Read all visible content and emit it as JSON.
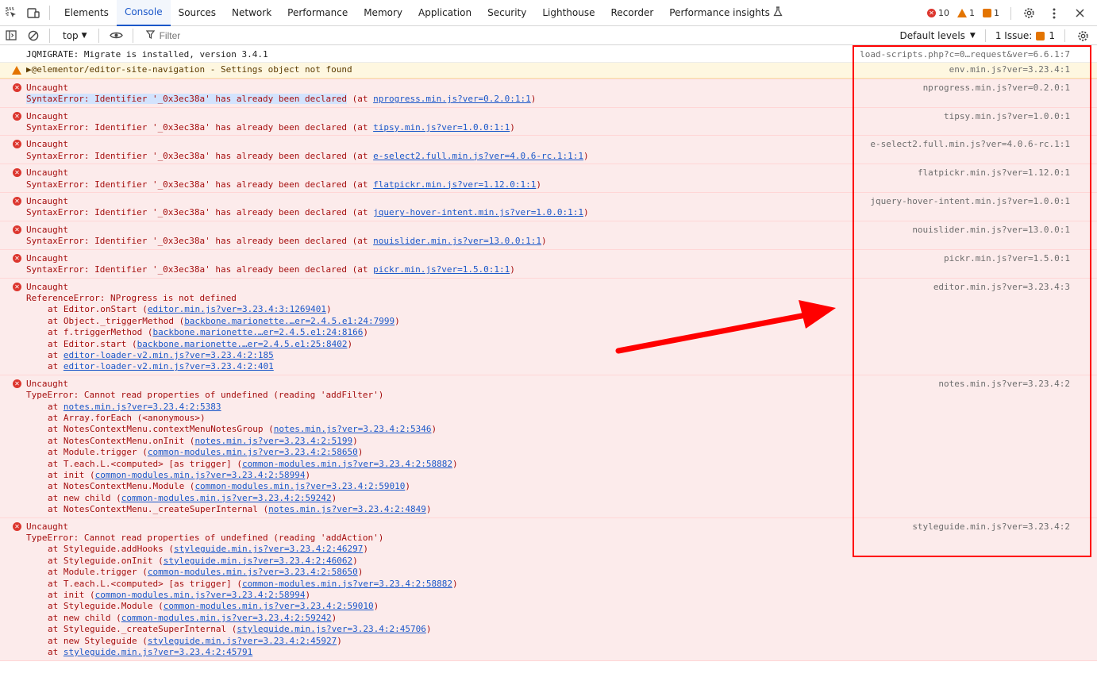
{
  "tabs": [
    {
      "label": "Elements",
      "active": false
    },
    {
      "label": "Console",
      "active": true
    },
    {
      "label": "Sources",
      "active": false
    },
    {
      "label": "Network",
      "active": false
    },
    {
      "label": "Performance",
      "active": false
    },
    {
      "label": "Memory",
      "active": false
    },
    {
      "label": "Application",
      "active": false
    },
    {
      "label": "Security",
      "active": false
    },
    {
      "label": "Lighthouse",
      "active": false
    },
    {
      "label": "Recorder",
      "active": false
    },
    {
      "label": "Performance insights",
      "active": false
    }
  ],
  "counts": {
    "errors": "10",
    "warnings": "1",
    "issues": "1"
  },
  "toolbar": {
    "context": "top",
    "filter_placeholder": "Filter",
    "levels": "Default levels",
    "issues": "1 Issue:",
    "issues_count": "1"
  },
  "messages": [
    {
      "level": "info",
      "lines": [
        [
          "JQMIGRATE: Migrate is installed, version 3.4.1"
        ]
      ],
      "source": "load-scripts.php?c=0…request&ver=6.6.1:7"
    },
    {
      "level": "warn",
      "lines": [
        [
          "▶@elementor/editor-site-navigation - Settings object not found"
        ]
      ],
      "source": "env.min.js?ver=3.23.4:1"
    },
    {
      "level": "error",
      "lines": [
        [
          "Uncaught"
        ],
        [
          "SyntaxError: Identifier '_0x3ec38a' has already been declared",
          " (at ",
          "nprogress.min.js?ver=0.2.0:1:1",
          ")"
        ]
      ],
      "source": "nprogress.min.js?ver=0.2.0:1",
      "highlight": true
    },
    {
      "level": "error",
      "lines": [
        [
          "Uncaught"
        ],
        [
          "SyntaxError: Identifier '_0x3ec38a' has already been declared",
          " (at ",
          "tipsy.min.js?ver=1.0.0:1:1",
          ")"
        ]
      ],
      "source": "tipsy.min.js?ver=1.0.0:1"
    },
    {
      "level": "error",
      "lines": [
        [
          "Uncaught"
        ],
        [
          "SyntaxError: Identifier '_0x3ec38a' has already been declared",
          " (at ",
          "e-select2.full.min.js?ver=4.0.6-rc.1:1:1",
          ")"
        ]
      ],
      "source": "e-select2.full.min.js?ver=4.0.6-rc.1:1"
    },
    {
      "level": "error",
      "lines": [
        [
          "Uncaught"
        ],
        [
          "SyntaxError: Identifier '_0x3ec38a' has already been declared",
          " (at ",
          "flatpickr.min.js?ver=1.12.0:1:1",
          ")"
        ]
      ],
      "source": "flatpickr.min.js?ver=1.12.0:1"
    },
    {
      "level": "error",
      "lines": [
        [
          "Uncaught"
        ],
        [
          "SyntaxError: Identifier '_0x3ec38a' has already been declared",
          " (at ",
          "jquery-hover-intent.min.js?ver=1.0.0:1:1",
          ")"
        ]
      ],
      "source": "jquery-hover-intent.min.js?ver=1.0.0:1"
    },
    {
      "level": "error",
      "lines": [
        [
          "Uncaught"
        ],
        [
          "SyntaxError: Identifier '_0x3ec38a' has already been declared",
          " (at ",
          "nouislider.min.js?ver=13.0.0:1:1",
          ")"
        ]
      ],
      "source": "nouislider.min.js?ver=13.0.0:1"
    },
    {
      "level": "error",
      "lines": [
        [
          "Uncaught"
        ],
        [
          "SyntaxError: Identifier '_0x3ec38a' has already been declared",
          " (at ",
          "pickr.min.js?ver=1.5.0:1:1",
          ")"
        ]
      ],
      "source": "pickr.min.js?ver=1.5.0:1"
    },
    {
      "level": "error",
      "lines": [
        [
          "Uncaught"
        ],
        [
          "ReferenceError: NProgress is not defined"
        ]
      ],
      "source": "editor.min.js?ver=3.23.4:3",
      "stack": [
        [
          "at Editor.onStart (",
          "editor.min.js?ver=3.23.4:3:1269401",
          ")"
        ],
        [
          "at Object._triggerMethod (",
          "backbone.marionette.…er=2.4.5.e1:24:7999",
          ")"
        ],
        [
          "at f.triggerMethod (",
          "backbone.marionette.…er=2.4.5.e1:24:8166",
          ")"
        ],
        [
          "at Editor.start (",
          "backbone.marionette.…er=2.4.5.e1:25:8402",
          ")"
        ],
        [
          "at ",
          "editor-loader-v2.min.js?ver=3.23.4:2:185",
          ""
        ],
        [
          "at ",
          "editor-loader-v2.min.js?ver=3.23.4:2:401",
          ""
        ]
      ]
    },
    {
      "level": "error",
      "lines": [
        [
          "Uncaught"
        ],
        [
          "TypeError: Cannot read properties of undefined (reading 'addFilter')"
        ]
      ],
      "source": "notes.min.js?ver=3.23.4:2",
      "stack": [
        [
          "at ",
          "notes.min.js?ver=3.23.4:2:5383",
          ""
        ],
        [
          "at Array.forEach (<anonymous>)",
          "",
          ""
        ],
        [
          "at NotesContextMenu.contextMenuNotesGroup (",
          "notes.min.js?ver=3.23.4:2:5346",
          ")"
        ],
        [
          "at NotesContextMenu.onInit (",
          "notes.min.js?ver=3.23.4:2:5199",
          ")"
        ],
        [
          "at Module.trigger (",
          "common-modules.min.js?ver=3.23.4:2:58650",
          ")"
        ],
        [
          "at T.each.L.<computed> [as trigger] (",
          "common-modules.min.js?ver=3.23.4:2:58882",
          ")"
        ],
        [
          "at init (",
          "common-modules.min.js?ver=3.23.4:2:58994",
          ")"
        ],
        [
          "at NotesContextMenu.Module (",
          "common-modules.min.js?ver=3.23.4:2:59010",
          ")"
        ],
        [
          "at new child (",
          "common-modules.min.js?ver=3.23.4:2:59242",
          ")"
        ],
        [
          "at NotesContextMenu._createSuperInternal (",
          "notes.min.js?ver=3.23.4:2:4849",
          ")"
        ]
      ]
    },
    {
      "level": "error",
      "lines": [
        [
          "Uncaught"
        ],
        [
          "TypeError: Cannot read properties of undefined (reading 'addAction')"
        ]
      ],
      "source": "styleguide.min.js?ver=3.23.4:2",
      "stack": [
        [
          "at Styleguide.addHooks (",
          "styleguide.min.js?ver=3.23.4:2:46297",
          ")"
        ],
        [
          "at Styleguide.onInit (",
          "styleguide.min.js?ver=3.23.4:2:46062",
          ")"
        ],
        [
          "at Module.trigger (",
          "common-modules.min.js?ver=3.23.4:2:58650",
          ")"
        ],
        [
          "at T.each.L.<computed> [as trigger] (",
          "common-modules.min.js?ver=3.23.4:2:58882",
          ")"
        ],
        [
          "at init (",
          "common-modules.min.js?ver=3.23.4:2:58994",
          ")"
        ],
        [
          "at Styleguide.Module (",
          "common-modules.min.js?ver=3.23.4:2:59010",
          ")"
        ],
        [
          "at new child (",
          "common-modules.min.js?ver=3.23.4:2:59242",
          ")"
        ],
        [
          "at Styleguide._createSuperInternal (",
          "styleguide.min.js?ver=3.23.4:2:45706",
          ")"
        ],
        [
          "at new Styleguide (",
          "styleguide.min.js?ver=3.23.4:2:45927",
          ")"
        ],
        [
          "at ",
          "styleguide.min.js?ver=3.23.4:2:45791",
          ""
        ]
      ]
    }
  ],
  "colors": {
    "accent": "#1a57c9",
    "error": "#dc362e",
    "warning": "#e37400",
    "annotation": "#ff0000"
  }
}
